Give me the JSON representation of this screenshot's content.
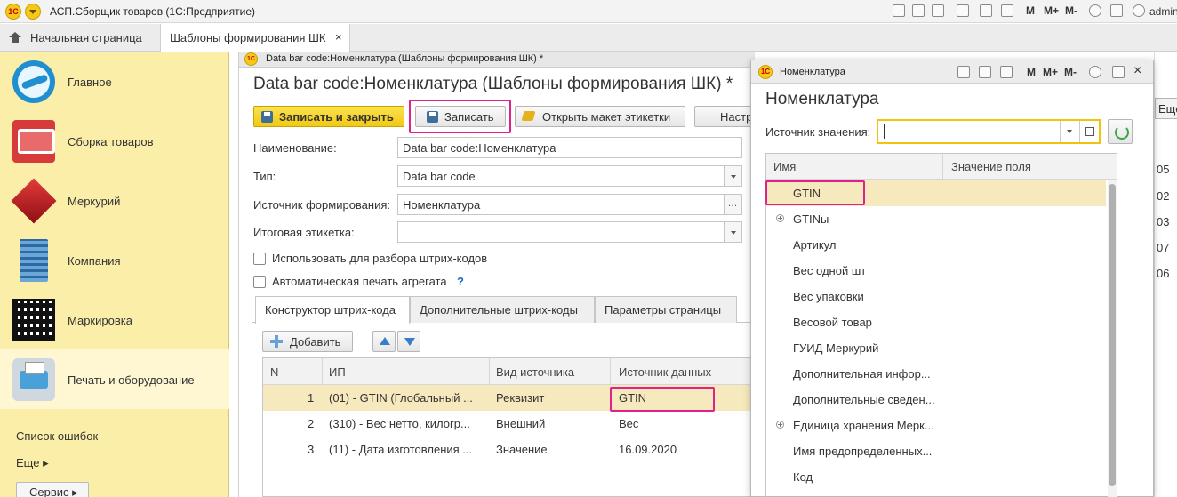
{
  "app": {
    "logo_text": "1С",
    "title": "АСП.Сборщик товаров  (1С:Предприятие)",
    "toolbar_letters": [
      "M",
      "M+",
      "M-"
    ],
    "user": "admin"
  },
  "tabs": {
    "home": "Начальная страница",
    "active": "Шаблоны формирования ШК",
    "close": "×"
  },
  "sidebar": {
    "items": [
      {
        "label": "Главное",
        "icon": "globe-icon"
      },
      {
        "label": "Сборка товаров",
        "icon": "cart-icon"
      },
      {
        "label": "Меркурий",
        "icon": "mercury-cube-icon"
      },
      {
        "label": "Компания",
        "icon": "building-icon"
      },
      {
        "label": "Маркировка",
        "icon": "qr-code-icon"
      },
      {
        "label": "Печать и оборудование",
        "icon": "printer-terminal-icon"
      }
    ],
    "errors_link": "Список ошибок",
    "more_link": "Еще ▸",
    "service_button": "Сервис ▸"
  },
  "doc": {
    "window_title": "Data bar code:Номенклатура (Шаблоны формирования ШК) *",
    "heading": "Data bar code:Номенклатура (Шаблоны формирования ШК) *",
    "btn_save_close": "Записать и закрыть",
    "btn_save": "Записать",
    "btn_open_template": "Открыть макет этикетки",
    "btn_setup": "Настр",
    "fields": [
      {
        "label": "Наименование:",
        "value": "Data bar code:Номенклатура"
      },
      {
        "label": "Тип:",
        "value": "Data bar code"
      },
      {
        "label": "Источник формирования:",
        "value": "Номенклатура"
      },
      {
        "label": "Итоговая этикетка:",
        "value": ""
      }
    ],
    "checkbox_parse": "Использовать для разбора штрих-кодов",
    "checkbox_autoprint": "Автоматическая печать агрегата",
    "help": "?",
    "tabs": [
      "Конструктор штрих-кода",
      "Дополнительные штрих-коды",
      "Параметры страницы"
    ],
    "btn_add": "Добавить",
    "grid": {
      "columns": [
        "N",
        "ИП",
        "Вид источника",
        "Источник данных"
      ],
      "rows": [
        {
          "n": "1",
          "ip": "(01) - GTIN (Глобальный ...",
          "kind": "Реквизит",
          "source": "GTIN"
        },
        {
          "n": "2",
          "ip": "(310) - Вес нетто, килогр...",
          "kind": "Внешний",
          "source": "Вес"
        },
        {
          "n": "3",
          "ip": "(11) - Дата изготовления ...",
          "kind": "Значение",
          "source": "16.09.2020"
        }
      ]
    }
  },
  "popup": {
    "window_title": "Номенклатура",
    "heading": "Номенклатура",
    "source_label": "Источник значения:",
    "source_value": "",
    "columns": [
      "Имя",
      "Значение поля"
    ],
    "rows": [
      {
        "name": "GTIN",
        "expandable": false
      },
      {
        "name": "GTINы",
        "expandable": true
      },
      {
        "name": "Артикул",
        "expandable": false
      },
      {
        "name": "Вес одной шт",
        "expandable": false
      },
      {
        "name": "Вес упаковки",
        "expandable": false
      },
      {
        "name": "Весовой товар",
        "expandable": false
      },
      {
        "name": "ГУИД Меркурий",
        "expandable": false
      },
      {
        "name": "Дополнительная инфор...",
        "expandable": false
      },
      {
        "name": "Дополнительные сведен...",
        "expandable": false
      },
      {
        "name": "Единица хранения Мерк...",
        "expandable": true
      },
      {
        "name": "Имя предопределенных...",
        "expandable": false
      },
      {
        "name": "Код",
        "expandable": false
      }
    ]
  },
  "background": {
    "more_button": "Еще",
    "numbers": [
      "05",
      "02",
      "03",
      "07",
      "06"
    ]
  },
  "colors": {
    "sidebar_bg": "#fbeea9",
    "primary_button": "#f1c915",
    "highlight_frame": "#e0218a",
    "selected_row": "#f7e9be",
    "focus_field": "#f1c30e"
  }
}
